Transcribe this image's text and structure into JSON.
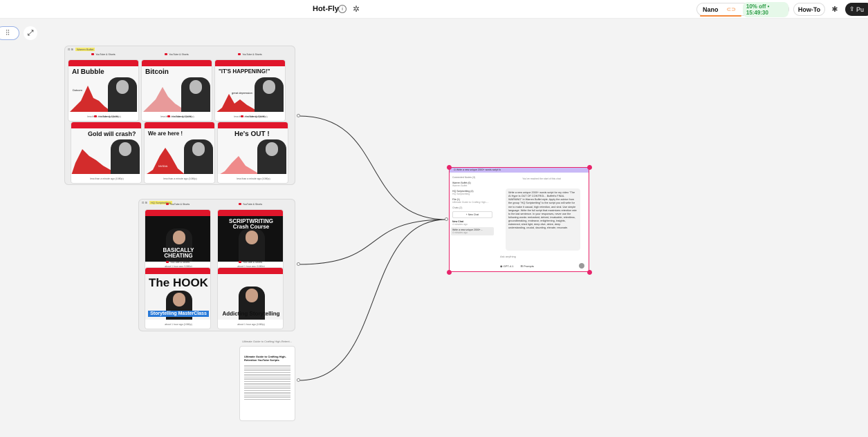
{
  "header": {
    "title": "Hot-Fly",
    "nano_label": "Nano",
    "promo": "10% off • 15:49:30",
    "howto": "How-To",
    "publish": "Pu"
  },
  "groups": [
    {
      "tag": "Warren Buffet"
    },
    {
      "tag": "HQ Scriptwriting"
    }
  ],
  "card_header": "YouTube & Shorts",
  "buffett_cards": [
    {
      "headline": "AI Bubble",
      "note": "Dotcom",
      "foot": "less than a minute ago (1080p)"
    },
    {
      "headline": "Bitcoin",
      "note": "",
      "foot": "less than a minute ago (1080p)"
    },
    {
      "headline": "\"IT'S HAPPENING!\"",
      "note": "great depression",
      "foot": "less than a minute ago (1080p)"
    },
    {
      "headline": "Gold will crash?",
      "note": "",
      "foot": "less than a minute ago (1080p)"
    },
    {
      "headline": "We are here !",
      "note": "NVIDIA",
      "foot": "less than a minute ago (1080p)"
    },
    {
      "headline": "He's OUT !",
      "note": "",
      "foot": "less than a minute ago (1080p)"
    }
  ],
  "hq_cards": [
    {
      "headline": "BASICALLY CHEATING",
      "foot": "about 1 hour ago (1080p)"
    },
    {
      "headline": "SCRIPTWRITING Crash Course",
      "foot": "about 1 hour ago (1080p)"
    },
    {
      "headline": "The HOOK",
      "sub": "Storytelling MasterClass",
      "foot": "about 1 hour ago (1080p)"
    },
    {
      "headline": "Addicting Storytelling",
      "foot": "about 1 hour ago (1080p)"
    }
  ],
  "doc": {
    "label": "Ultimate Guide to Crafting High-Retent...",
    "title": "Ultimate Guide to Crafting High-Retention YouTube Scripts"
  },
  "chat": {
    "header": "Write a new unique 2000+ words script fo",
    "connected": "Connected Nodes (3)",
    "nodes": [
      {
        "name": "Warren Buffet (6)",
        "sub": "Warren Buffet"
      },
      {
        "name": "HQ Scriptwriting (4)",
        "sub": "HQ Scriptwriting"
      },
      {
        "name": "File (1)",
        "sub": "Ultimate Guide to Crafting High-..."
      }
    ],
    "chats_label": "Chats (2)",
    "new_chat": "+ New Chat",
    "chats": [
      {
        "name": "New Chat",
        "time": "4 minutes ago"
      },
      {
        "name": "Write a new unique 2000+...",
        "time": "4 minutes ago"
      }
    ],
    "start_note": "You've reached the start of this chat",
    "message": "Write a new unique 2000+ words script for my video \"The AI Hype Is OUT OF CONTROL - Buffett's FINAL WARNING\" in Warren Buffet style. Apply the advice from the group \"HQ Scriptwriting\" to the script you will write for me to make it casual, high retention, and viral. Use simple language. Write the full script that maximizes retention rate to the last sentence. In your responses, never use the following words: embarked, delved, invaluable, relentless, groundbreaking, endeavor, enlightening, insights, esteemed, shed light, deep dive, delve, deep understanding, crucial, daunting, elevate, resonate.",
    "placeholder": "Ask anything",
    "model": "GPT-4.1",
    "prompts": "Prompts"
  }
}
